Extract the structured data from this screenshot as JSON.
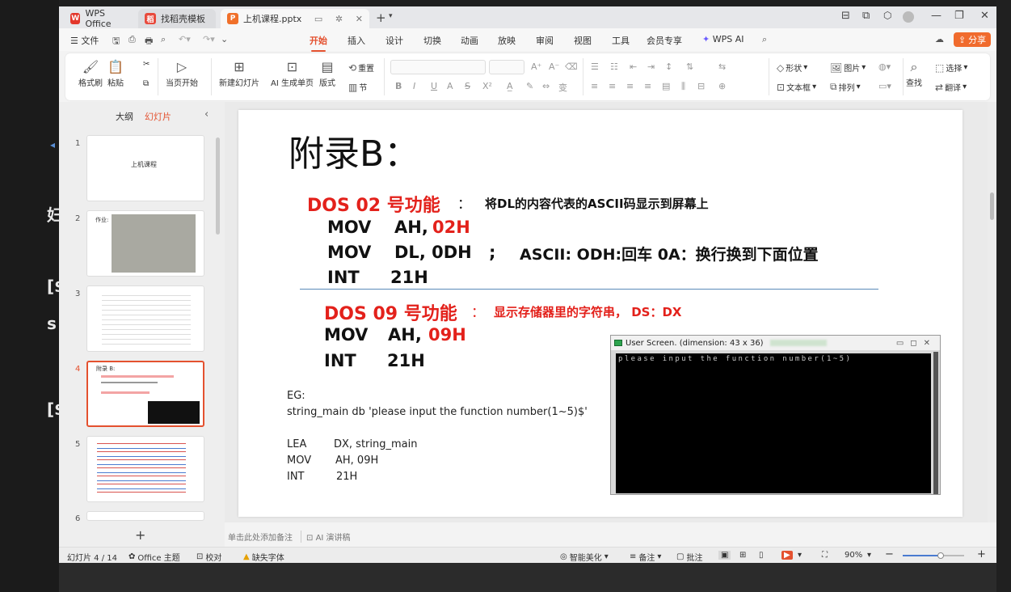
{
  "background_left_chars": [
    "◂",
    "妇",
    "[$",
    "s",
    "[$"
  ],
  "tabs": [
    {
      "label": "WPS Office",
      "logo": "W",
      "color": "#e3372b"
    },
    {
      "label": "找稻壳模板",
      "logo": "稻",
      "color": "#e84a3c"
    },
    {
      "label": "上机课程.pptx",
      "logo": "P",
      "color": "#f0702a"
    }
  ],
  "window_controls": [
    "⊟",
    "⧉",
    "—",
    "❐",
    "✕"
  ],
  "menu": {
    "file": "文件",
    "items": [
      "开始",
      "插入",
      "设计",
      "切换",
      "动画",
      "放映",
      "审阅",
      "视图",
      "工具",
      "会员专享",
      "WPS AI"
    ],
    "active": "开始",
    "share": "分享"
  },
  "ribbon": {
    "format_painter": "格式刷",
    "paste": "粘贴",
    "play_from_current": "当页开始",
    "new_slide": "新建幻灯片",
    "ai_slide": "AI 生成单页",
    "layout": "版式",
    "reset": "重置",
    "section": "节",
    "shape": "形状",
    "image": "图片",
    "textbox": "文本框",
    "arrange": "排列",
    "find": "查找",
    "select": "选择",
    "translate": "翻译"
  },
  "panel": {
    "tab_outline": "大纲",
    "tab_slides": "幻灯片",
    "add": "+",
    "thumbs": [
      {
        "num": "1",
        "text": "上机课程"
      },
      {
        "num": "2",
        "text": "作业:"
      },
      {
        "num": "3",
        "text": ""
      },
      {
        "num": "4",
        "text": "附录 B:"
      },
      {
        "num": "5",
        "text": ""
      },
      {
        "num": "6",
        "text": ""
      }
    ]
  },
  "slide": {
    "title": "附录B：",
    "dos02_label": "DOS  02  号功能",
    "dos02_colon": "：",
    "dos02_desc": "将DL的内容代表的ASCII码显示到屏幕上",
    "l1_mov": "MOV",
    "l1_ah": "AH,",
    "l1_val": "02H",
    "l2_mov": "MOV",
    "l2_dl": "DL,  0DH",
    "l2_semi": ";",
    "l2_comment": "ASCII:  ODH:回车  0A：换行换到下面位置",
    "l3_int": "INT",
    "l3_val": "21H",
    "dos09_label": "DOS  09  号功能",
    "dos09_colon": "：",
    "dos09_desc": "显示存储器里的字符串，  DS：DX",
    "l4_mov": "MOV",
    "l4_ah": "AH,",
    "l4_val": "09H",
    "l5_int": "INT",
    "l5_val": "21H",
    "eg": "EG:",
    "eg_line": "string_main  db 'please input the function number(1~5)$'",
    "lea": "LEA",
    "lea_arg": "DX,  string_main",
    "mov": "MOV",
    "mov_arg": "AH, 09H",
    "int": "INT",
    "int_arg": "21H"
  },
  "console": {
    "title": "User Screen. (dimension: 43 x 36)",
    "output": "please input the function number(1~5)"
  },
  "notes": {
    "placeholder": "单击此处添加备注",
    "ai_notes": "AI 演讲稿"
  },
  "status": {
    "slide_count": "幻灯片 4 / 14",
    "theme": "Office 主题",
    "proof": "校对",
    "missing_font": "缺失字体",
    "beautify": "智能美化",
    "notes": "备注",
    "comments": "批注",
    "zoom": "90%",
    "zoom_fraction": 0.62
  }
}
